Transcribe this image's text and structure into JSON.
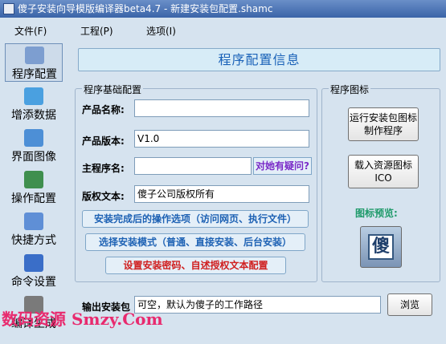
{
  "window": {
    "title": "傻子安装向导模版编译器beta4.7 - 新建安装包配置.shamc"
  },
  "menu": {
    "file": "文件(F)",
    "project": "工程(P)",
    "options": "选项(I)"
  },
  "sidebar": {
    "items": [
      {
        "label": "程序配置",
        "icon": "config-icon",
        "color": "#7d9ed0"
      },
      {
        "label": "增添数据",
        "icon": "add-data-icon",
        "color": "#4aa0e0"
      },
      {
        "label": "界面图像",
        "icon": "image-icon",
        "color": "#4d8fd6"
      },
      {
        "label": "操作配置",
        "icon": "operation-icon",
        "color": "#3f8f4e"
      },
      {
        "label": "快捷方式",
        "icon": "shortcut-icon",
        "color": "#5f8fd6"
      },
      {
        "label": "命令设置",
        "icon": "command-icon",
        "color": "#3a6ec8"
      },
      {
        "label": "编译生成",
        "icon": "build-icon",
        "color": "#7a7a7a"
      }
    ]
  },
  "banner": {
    "title": "程序配置信息"
  },
  "basic": {
    "group_title": "程序基础配置",
    "name_label": "产品名称:",
    "name_value": "",
    "version_label": "产品版本:",
    "version_value": "V1.0",
    "main_label": "主程序名:",
    "main_value": "",
    "question_button": "对她有疑问?",
    "copyright_label": "版权文本:",
    "copyright_value": "傻子公司版权所有",
    "after_install_button": "安装完成后的操作选项（访问网页、执行文件）",
    "install_mode_button": "选择安装模式（普通、直接安装、后台安装）",
    "password_button": "设置安装密码、自述授权文本配置"
  },
  "icon_group": {
    "group_title": "程序图标",
    "run_button": "运行安装包图标制作程序",
    "load_button": "载入资源图标ICO",
    "preview_label": "图标预览:",
    "preview_icon": "sha-icon",
    "preview_glyph": "傻"
  },
  "output": {
    "label": "输出安装包",
    "value": "可空，默认为傻子的工作路径",
    "browse_button": "浏览"
  },
  "watermark": {
    "text": "数码资源 Smzy.Com"
  }
}
